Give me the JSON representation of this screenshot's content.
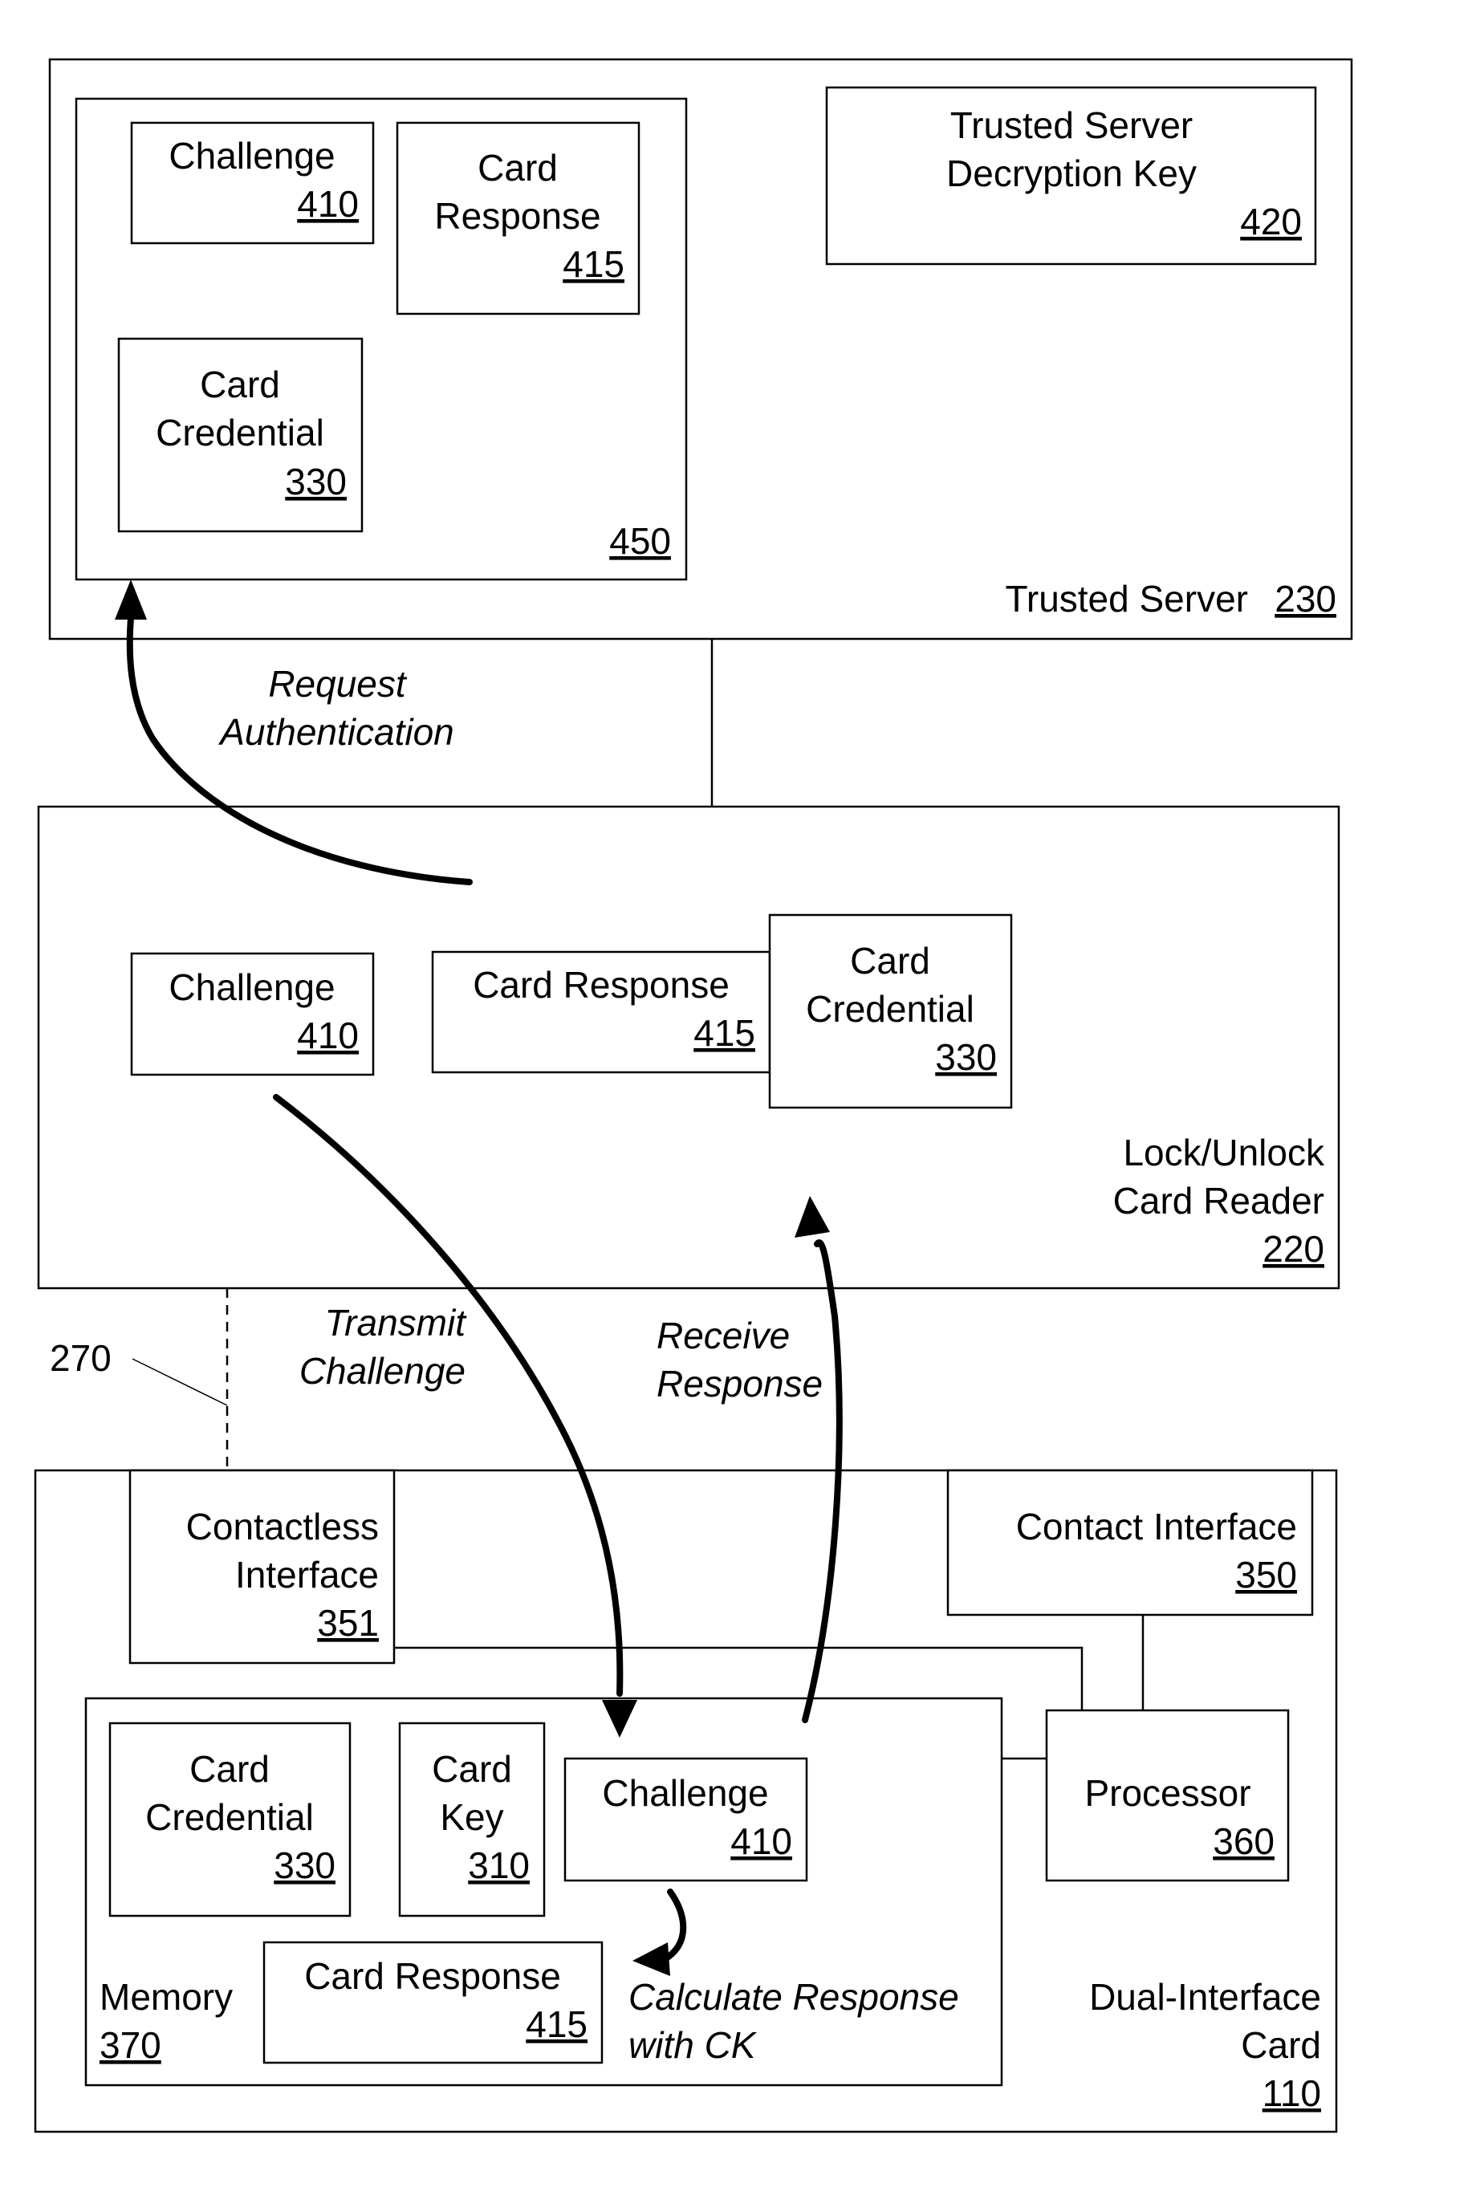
{
  "trusted_server": {
    "label": "Trusted Server",
    "ref": "230",
    "group": {
      "ref": "450",
      "challenge": {
        "line1": "Challenge",
        "ref": "410"
      },
      "card_response": {
        "line1": "Card",
        "line2": "Response",
        "ref": "415"
      },
      "card_credential": {
        "line1": "Card",
        "line2": "Credential",
        "ref": "330"
      }
    },
    "decryption_key": {
      "line1": "Trusted Server",
      "line2": "Decryption Key",
      "ref": "420"
    }
  },
  "reader": {
    "line1": "Lock/Unlock",
    "line2": "Card Reader",
    "ref": "220",
    "challenge": {
      "line1": "Challenge",
      "ref": "410"
    },
    "card_response": {
      "line1": "Card Response",
      "ref": "415"
    },
    "card_credential": {
      "line1": "Card",
      "line2": "Credential",
      "ref": "330"
    }
  },
  "card": {
    "line1": "Dual-Interface",
    "line2": "Card",
    "ref": "110",
    "contactless": {
      "line1": "Contactless",
      "line2": "Interface",
      "ref": "351"
    },
    "contact": {
      "line1": "Contact Interface",
      "ref": "350"
    },
    "processor": {
      "line1": "Processor",
      "ref": "360"
    },
    "memory": {
      "line1": "Memory",
      "ref": "370",
      "card_credential": {
        "line1": "Card",
        "line2": "Credential",
        "ref": "330"
      },
      "card_key": {
        "line1": "Card",
        "line2": "Key",
        "ref": "310"
      },
      "challenge": {
        "line1": "Challenge",
        "ref": "410"
      },
      "card_response": {
        "line1": "Card Response",
        "ref": "415"
      }
    }
  },
  "link_ref": "270",
  "arrows": {
    "request_auth": {
      "line1": "Request",
      "line2": "Authentication"
    },
    "transmit": {
      "line1": "Transmit",
      "line2": "Challenge"
    },
    "receive": {
      "line1": "Receive",
      "line2": "Response"
    },
    "calculate": {
      "line1": "Calculate Response",
      "line2": "with CK"
    }
  }
}
